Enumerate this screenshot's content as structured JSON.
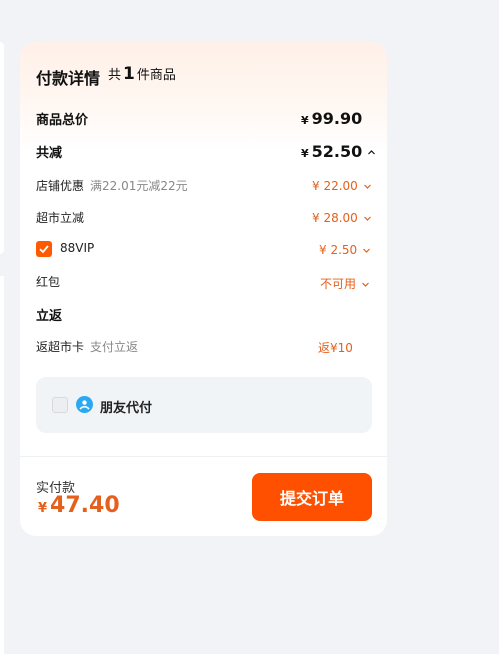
{
  "card": {
    "title": "付款详情",
    "count_prefix": "共",
    "count": "1",
    "count_suffix": "件商品"
  },
  "rows": {
    "total": {
      "label": "商品总价",
      "currency": "¥",
      "amount": "99.90"
    },
    "discount": {
      "label": "共减",
      "currency": "¥",
      "amount": "52.50"
    },
    "store_coupon": {
      "label": "店铺优惠",
      "note": "满22.01元减22元",
      "amount": "¥ 22.00"
    },
    "market_cut": {
      "label": "超市立减",
      "amount": "¥ 28.00"
    },
    "vip": {
      "label": "88VIP",
      "amount": "¥ 2.50",
      "checked": true
    },
    "red_packet": {
      "label": "红包",
      "amount": "不可用"
    },
    "rebate_title": "立返",
    "rebate": {
      "label": "返超市卡",
      "note": "支付立返",
      "amount": "返¥10"
    }
  },
  "friend_pay": {
    "label": "朋友代付",
    "checked": false,
    "icon": "friend-pay-icon"
  },
  "footer": {
    "pay_label": "实付款",
    "currency": "¥",
    "pay_amount": "47.40",
    "submit_label": "提交订单"
  },
  "colors": {
    "accent": "#ff5000",
    "price_orange": "#e4601c",
    "friend_icon": "#2aa9f2",
    "background": "#f1f3f6"
  }
}
